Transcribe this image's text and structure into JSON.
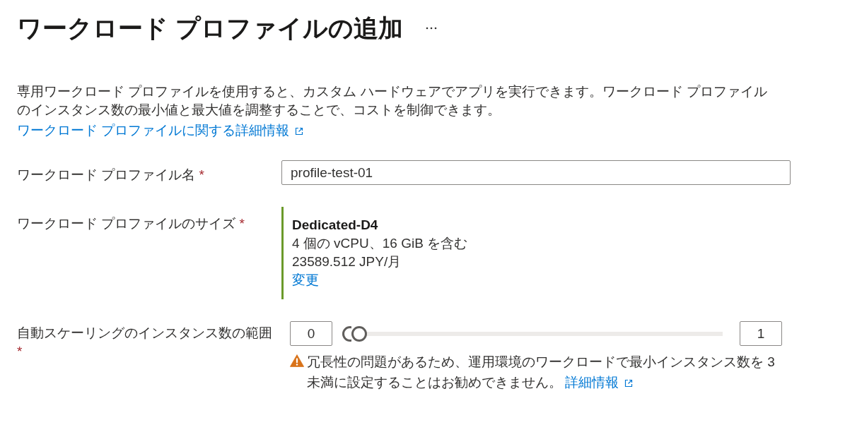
{
  "header": {
    "title": "ワークロード プロファイルの追加"
  },
  "intro": {
    "description": "専用ワークロード プロファイルを使用すると、カスタム ハードウェアでアプリを実行できます。ワークロード プロファイルのインスタンス数の最小値と最大値を調整することで、コストを制御できます。",
    "link": "ワークロード プロファイルに関する詳細情報"
  },
  "form": {
    "fields": [
      {
        "kind": "text",
        "label": "ワークロード プロファイル名",
        "required_mark": "*",
        "value": "profile-test-01"
      },
      {
        "kind": "size",
        "label": "ワークロード プロファイルのサイズ",
        "required_mark": "*",
        "size": {
          "name": "Dedicated-D4",
          "specs": "4 個の vCPU、16 GiB を含む",
          "price": "23589.512 JPY/月",
          "change_link": "変更"
        }
      },
      {
        "kind": "range",
        "label": "自動スケーリングのインスタンス数の範囲",
        "required_mark": "*",
        "min_value": "0",
        "max_value": "1",
        "thumbs": [
          {
            "level": 0
          },
          {
            "level": 0.025
          }
        ],
        "warning": {
          "text": "冗長性の問題があるため、運用環境のワークロードで最小インスタンス数を 3 未満に設定することはお勧めできません。",
          "link": "詳細情報"
        }
      }
    ]
  }
}
